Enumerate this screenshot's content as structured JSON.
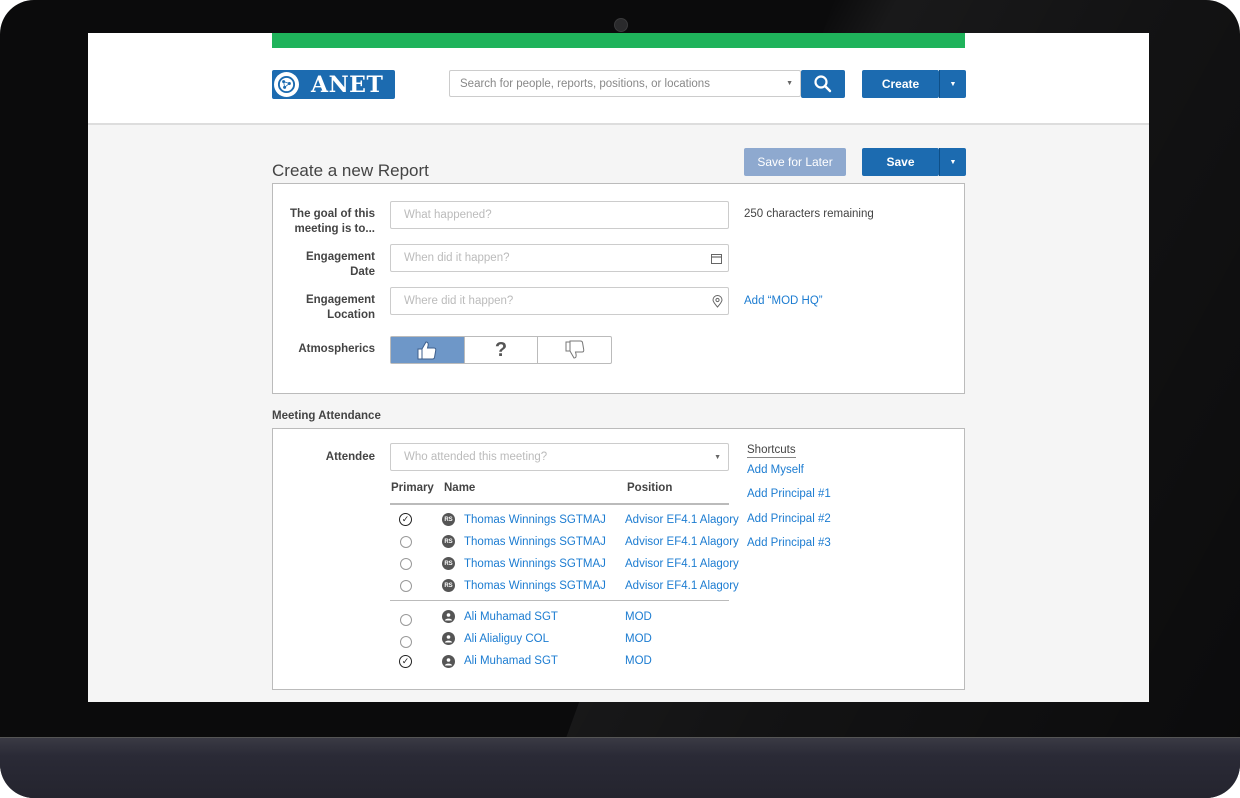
{
  "header": {
    "logo_text": "ANET",
    "search_placeholder": "Search for people, reports, positions, or locations",
    "create_label": "Create"
  },
  "page": {
    "title": "Create a new Report",
    "save_later_label": "Save for Later",
    "save_label": "Save"
  },
  "form": {
    "goal_label": "The goal of this meeting is to...",
    "goal_placeholder": "What happened?",
    "chars_remaining": "250 characters remaining",
    "date_label": "Engagement Date",
    "date_placeholder": "When did it happen?",
    "location_label": "Engagement Location",
    "location_placeholder": "Where did it happen?",
    "add_location_link": "Add “MOD HQ”",
    "atmospherics_label": "Atmospherics",
    "atmospherics_selected": "positive",
    "atmospherics_neutral_glyph": "?"
  },
  "attendance": {
    "section_title": "Meeting Attendance",
    "attendee_label": "Attendee",
    "attendee_placeholder": "Who attended this meeting?",
    "columns": [
      "Primary",
      "Name",
      "Position"
    ],
    "advisors": [
      {
        "primary": true,
        "initials": "RS",
        "name": "Thomas Winnings SGTMAJ",
        "position": "Advisor EF4.1 Alagory"
      },
      {
        "primary": false,
        "initials": "RS",
        "name": "Thomas Winnings SGTMAJ",
        "position": "Advisor EF4.1 Alagory"
      },
      {
        "primary": false,
        "initials": "RS",
        "name": "Thomas Winnings SGTMAJ",
        "position": "Advisor EF4.1 Alagory"
      },
      {
        "primary": false,
        "initials": "RS",
        "name": "Thomas Winnings SGTMAJ",
        "position": "Advisor EF4.1 Alagory"
      }
    ],
    "principals": [
      {
        "primary": false,
        "name": "Ali Muhamad SGT",
        "position": "MOD"
      },
      {
        "primary": false,
        "name": "Ali Alialiguy COL",
        "position": "MOD"
      },
      {
        "primary": true,
        "name": "Ali Muhamad SGT",
        "position": "MOD"
      }
    ],
    "shortcuts_title": "Shortcuts",
    "shortcuts": [
      "Add Myself",
      "Add Principal #1",
      "Add Principal #2",
      "Add Principal #3"
    ]
  },
  "colors": {
    "brand_blue": "#1c6bb0",
    "accent_green": "#1fb35b",
    "link_blue": "#1c7cd1"
  }
}
